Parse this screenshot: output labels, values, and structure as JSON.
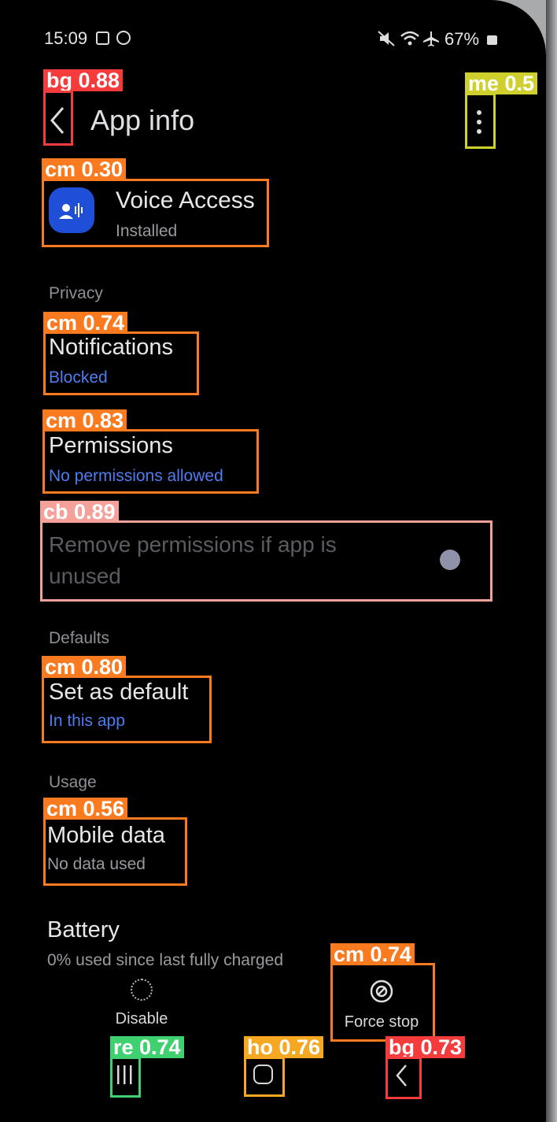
{
  "status_bar": {
    "time": "15:09",
    "battery": "67%",
    "icons": [
      "mute-icon",
      "wifi-icon",
      "airplane-icon",
      "battery-icon"
    ]
  },
  "header": {
    "title": "App info"
  },
  "app": {
    "name": "Voice Access",
    "status": "Installed"
  },
  "sections": {
    "privacy": "Privacy",
    "defaults": "Defaults",
    "usage": "Usage"
  },
  "items": {
    "notifications": {
      "title": "Notifications",
      "sub": "Blocked"
    },
    "permissions": {
      "title": "Permissions",
      "sub": "No permissions allowed"
    },
    "remove_permissions": {
      "line1": "Remove permissions if app is",
      "line2": "unused"
    },
    "set_default": {
      "title": "Set as default",
      "sub": "In this app"
    },
    "mobile_data": {
      "title": "Mobile data",
      "sub": "No data used"
    },
    "battery": {
      "title": "Battery",
      "sub": "0% used since last fully charged"
    }
  },
  "actions": {
    "disable": "Disable",
    "force_stop": "Force stop"
  },
  "detections": [
    {
      "key": "bg1",
      "label": "bg 0.88",
      "color": "#f53b3b"
    },
    {
      "key": "me",
      "label": "me 0.5",
      "color": "#cfcf2e"
    },
    {
      "key": "cm1",
      "label": "cm 0.30",
      "color": "#fa7a1f"
    },
    {
      "key": "cm2",
      "label": "cm 0.74",
      "color": "#fa7a1f"
    },
    {
      "key": "cm3",
      "label": "cm 0.83",
      "color": "#fa7a1f"
    },
    {
      "key": "cb",
      "label": "cb 0.89",
      "color": "#f6a09a"
    },
    {
      "key": "cm4",
      "label": "cm 0.80",
      "color": "#fa7a1f"
    },
    {
      "key": "cm5",
      "label": "cm 0.56",
      "color": "#fa7a1f"
    },
    {
      "key": "cm6",
      "label": "cm 0.74",
      "color": "#fa7a1f"
    },
    {
      "key": "re",
      "label": "re 0.74",
      "color": "#3fd16f"
    },
    {
      "key": "ho",
      "label": "ho 0.76",
      "color": "#f7a823"
    },
    {
      "key": "bg2",
      "label": "bg 0.73",
      "color": "#f53b3b"
    }
  ]
}
